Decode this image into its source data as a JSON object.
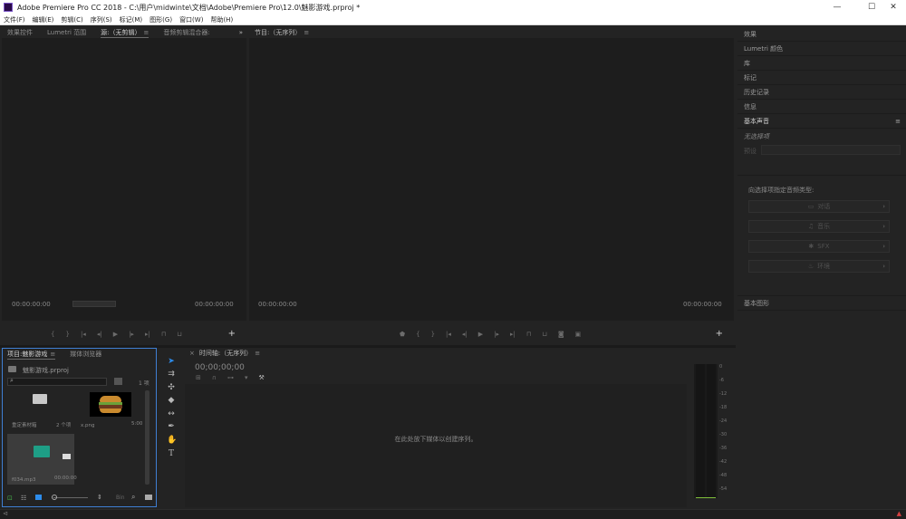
{
  "window": {
    "title": "Adobe Premiere Pro CC 2018 - C:\\用户\\midwinte\\文档\\Adobe\\Premiere Pro\\12.0\\魅影游戏.prproj *",
    "minimize": "—",
    "maximize": "☐",
    "close": "✕"
  },
  "menu": [
    "文件(F)",
    "编辑(E)",
    "剪辑(C)",
    "序列(S)",
    "标记(M)",
    "图形(G)",
    "窗口(W)",
    "帮助(H)"
  ],
  "source_panel": {
    "tabs": [
      "效果控件",
      "Lumetri 范围",
      "源:（无剪辑）",
      "音频剪辑混合器:"
    ],
    "overflow": "»",
    "timecode_left": "00:00:00:00",
    "timecode_right": "00:00:00:00",
    "add": "+"
  },
  "program_panel": {
    "tab": "节目:（无序列）",
    "timecode_left": "00:00:00:00",
    "timecode_right": "00:00:00:00",
    "add": "+"
  },
  "right_panel": {
    "items": [
      "效果",
      "Lumetri 颜色",
      "库",
      "标记",
      "历史记录",
      "信息"
    ],
    "essential_sound": "基本声音",
    "no_selection": "无选择项",
    "preset_label": "预设",
    "assign_label": "向选择项指定音频类型:",
    "buttons": [
      "对话",
      "音乐",
      "SFX",
      "环境"
    ],
    "essential_graphics": "基本图形"
  },
  "project_panel": {
    "tabs": [
      "项目:魅影游戏",
      "媒体浏览器"
    ],
    "filename": "魅影游戏.prproj",
    "count": "1 项",
    "items": [
      {
        "name": "重定素材箱",
        "meta": "2 个项"
      },
      {
        "name": "x.png",
        "meta": "5:00"
      },
      {
        "name": "f034.mp3",
        "meta": "00:00:00"
      }
    ],
    "footer_label": "Bin"
  },
  "timeline_panel": {
    "tab": "时间轴:（无序列）",
    "timecode": "00;00;00;00",
    "hint": "在此处放下媒体以创建序列。"
  },
  "meter": {
    "ticks": [
      "0",
      "-6",
      "-12",
      "-18",
      "-24",
      "-30",
      "-36",
      "-42",
      "-48",
      "-54"
    ]
  },
  "colors": {
    "accent_blue": "#2d8ceb",
    "selection_border": "#3f7fd3",
    "playhead": "#2d8ceb"
  }
}
